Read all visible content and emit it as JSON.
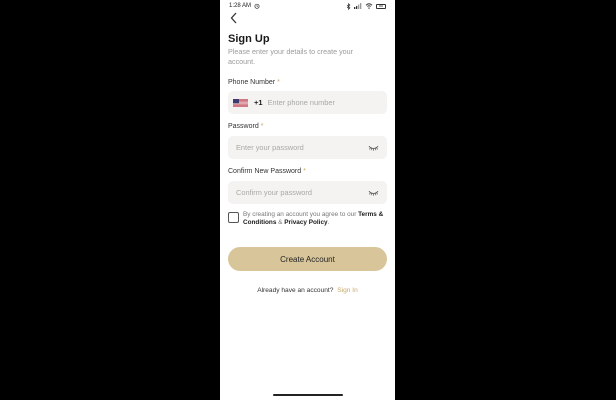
{
  "status_bar": {
    "time": "1:28 AM",
    "battery": "88"
  },
  "header": {
    "title": "Sign Up",
    "subtitle": "Please enter your details to create your account."
  },
  "phone": {
    "label": "Phone Number",
    "required_mark": "*",
    "country_code": "+1",
    "placeholder": "Enter phone number",
    "flag": "us-flag-icon"
  },
  "password": {
    "label": "Password",
    "required_mark": "*",
    "placeholder": "Enter your password"
  },
  "confirm_password": {
    "label": "Confirm New Password",
    "required_mark": "*",
    "placeholder": "Confirm your password"
  },
  "terms": {
    "prefix": "By creating an account you agree to our ",
    "terms_link": "Terms & Conditions",
    "joiner": " & ",
    "privacy_link": "Privacy Policy",
    "suffix": "."
  },
  "create_button": "Create Account",
  "footer": {
    "prompt": "Already have an account?",
    "sign_in_link": "Sign In"
  },
  "colors": {
    "accent": "#c9a96a",
    "button": "#d8c69a",
    "field_bg": "#f4f3f1"
  }
}
